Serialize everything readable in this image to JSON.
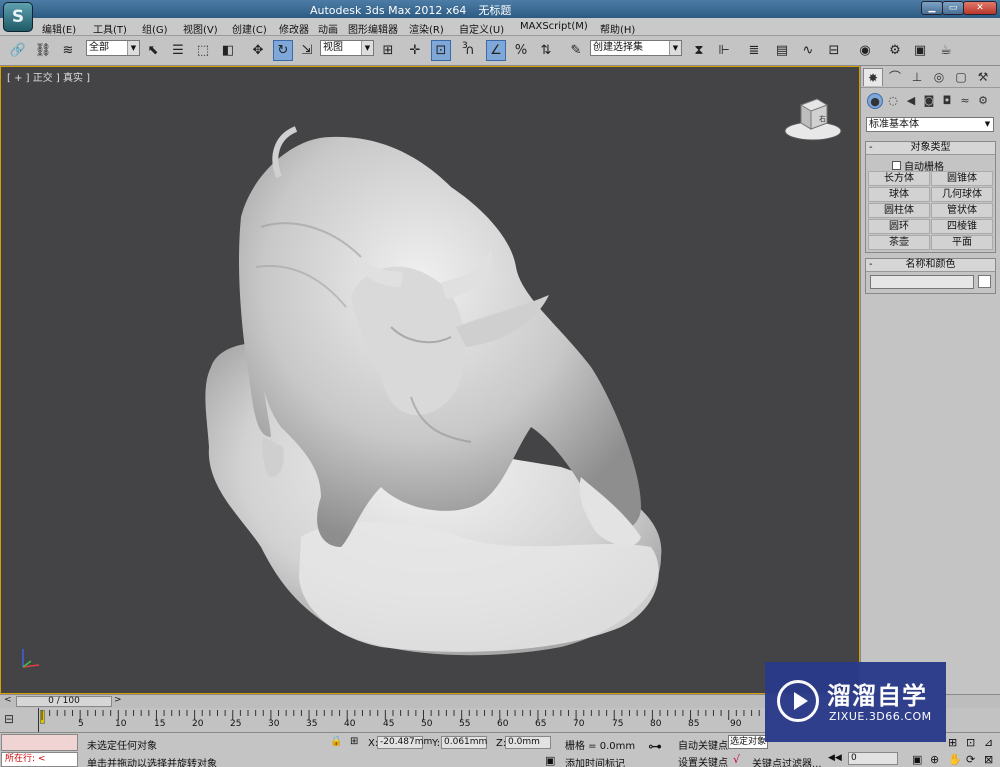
{
  "window": {
    "title": "Autodesk 3ds Max  2012 x64",
    "document": "无标题",
    "app_icon": "3ds-max-logo-icon"
  },
  "menu": [
    "编辑(E)",
    "工具(T)",
    "组(G)",
    "视图(V)",
    "创建(C)",
    "修改器",
    "动画",
    "图形编辑器",
    "渲染(R)",
    "自定义(U)",
    "MAXScript(M)",
    "帮助(H)"
  ],
  "toolbar": {
    "selection_filter": "全部",
    "ref_coord": "视图",
    "named_selection": "创建选择集",
    "angle_snap_label": "3",
    "percent_snap_label": "%"
  },
  "viewport": {
    "label": "[ + ] 正交 ] 真实 ]",
    "viewcube_face": "右"
  },
  "command_panel": {
    "category": "标准基本体",
    "object_type": {
      "title": "对象类型",
      "autogrid": "自动栅格",
      "buttons": [
        "长方体",
        "圆锥体",
        "球体",
        "几何球体",
        "圆柱体",
        "管状体",
        "圆环",
        "四棱锥",
        "茶壶",
        "平面"
      ]
    },
    "name_color": {
      "title": "名称和颜色",
      "name_value": "",
      "color": "#ffffff"
    }
  },
  "timeline": {
    "frame_display": "0 / 100",
    "ticks": [
      "0",
      "5",
      "10",
      "15",
      "20",
      "25",
      "30",
      "35",
      "40",
      "45",
      "50",
      "55",
      "60",
      "65",
      "70",
      "75",
      "80",
      "85",
      "90"
    ]
  },
  "status": {
    "running": "所在行:",
    "selection_info": "未选定任何对象",
    "prompt": "单击并拖动以选择并旋转对象",
    "x_label": "X:",
    "x_value": "-20.487mm",
    "y_label": "Y:",
    "y_value": "0.061mm",
    "z_label": "Z:",
    "z_value": "0.0mm",
    "grid": "栅格 = 0.0mm",
    "add_time_tag": "添加时间标记",
    "auto_key": "自动关键点",
    "set_key": "设置关键点",
    "selected_dropdown": "选定对象",
    "key_filters": "关键点过滤器...",
    "frame_value": "0"
  },
  "watermark": {
    "title": "溜溜自学",
    "url": "ZIXUE.3D66.COM"
  }
}
